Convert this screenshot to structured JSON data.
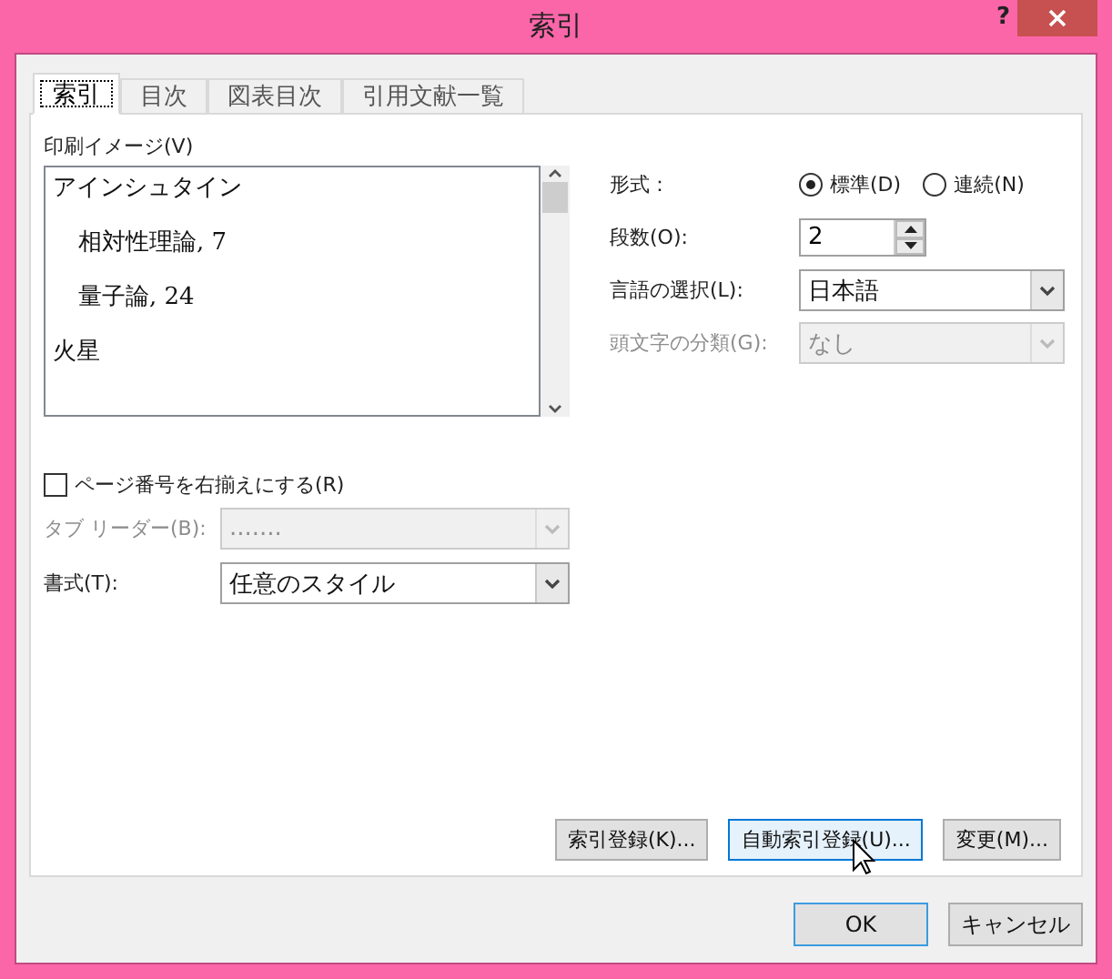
{
  "window": {
    "title": "索引",
    "help": "?"
  },
  "tabs": [
    {
      "label": "索引",
      "selected": true
    },
    {
      "label": "目次",
      "selected": false
    },
    {
      "label": "図表目次",
      "selected": false
    },
    {
      "label": "引用文献一覧",
      "selected": false
    }
  ],
  "preview": {
    "label": "印刷イメージ(V)",
    "entries": [
      {
        "text": "アインシュタイン",
        "children": [
          {
            "text": "相対性理論, 7"
          },
          {
            "text": "量子論, 24"
          }
        ]
      },
      {
        "text": "火星"
      }
    ]
  },
  "right_align": {
    "label": "ページ番号を右揃えにする(R)",
    "checked": false
  },
  "tab_leader": {
    "label": "タブ リーダー(B):",
    "value": ".......",
    "disabled": true
  },
  "style": {
    "label": "書式(T):",
    "value": "任意のスタイル",
    "disabled": false
  },
  "format": {
    "label": "形式：",
    "options": [
      {
        "label": "標準(D)",
        "selected": true
      },
      {
        "label": "連続(N)",
        "selected": false
      }
    ]
  },
  "columns": {
    "label": "段数(O):",
    "value": "2"
  },
  "language": {
    "label": "言語の選択(L):",
    "value": "日本語",
    "disabled": false
  },
  "heading": {
    "label": "頭文字の分類(G):",
    "value": "なし",
    "disabled": true
  },
  "actions": [
    {
      "label": "索引登録(K)...",
      "hover": false
    },
    {
      "label": "自動索引登録(U)...",
      "hover": true
    },
    {
      "label": "変更(M)...",
      "hover": false
    }
  ],
  "buttons": [
    {
      "label": "OK",
      "default": true
    },
    {
      "label": "キャンセル",
      "default": false
    }
  ]
}
